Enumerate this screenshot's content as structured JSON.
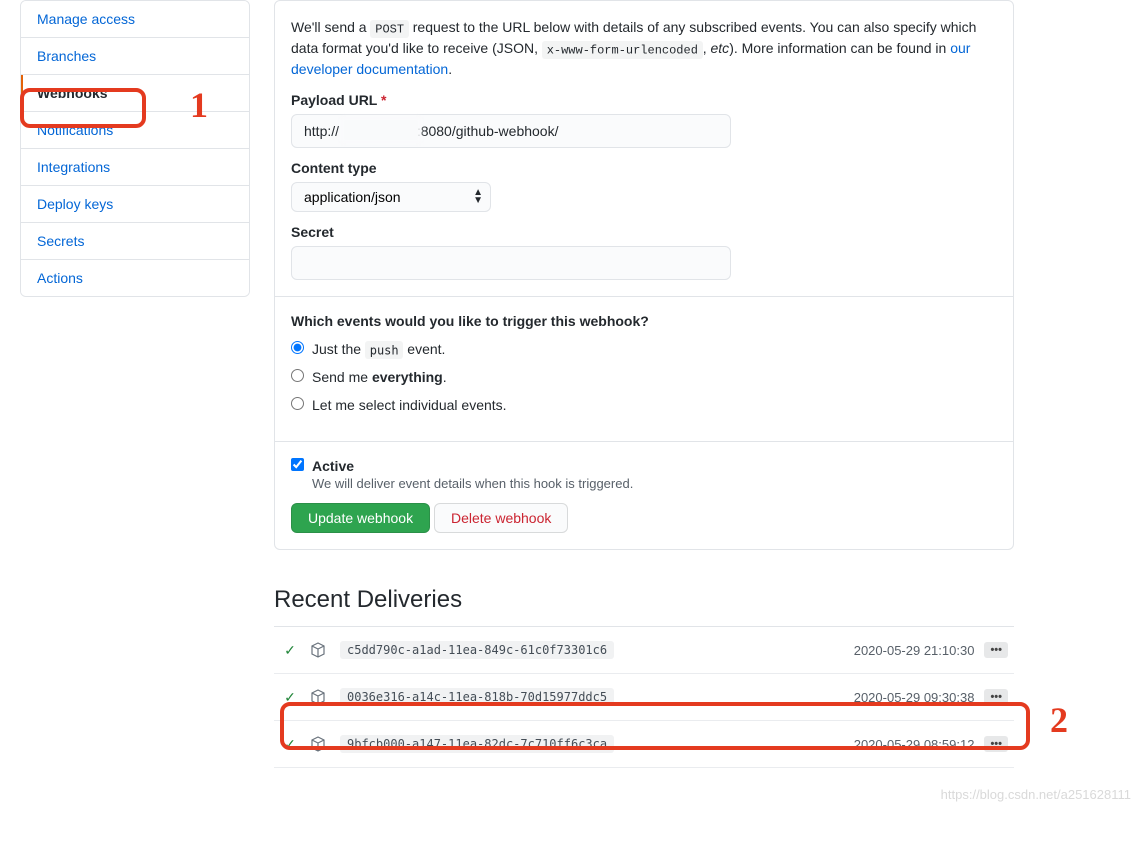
{
  "sidebar": {
    "items": [
      {
        "label": "Manage access",
        "active": false
      },
      {
        "label": "Branches",
        "active": false
      },
      {
        "label": "Webhooks",
        "active": true
      },
      {
        "label": "Notifications",
        "active": false
      },
      {
        "label": "Integrations",
        "active": false
      },
      {
        "label": "Deploy keys",
        "active": false
      },
      {
        "label": "Secrets",
        "active": false
      },
      {
        "label": "Actions",
        "active": false
      }
    ]
  },
  "form": {
    "intro_pre": "We'll send a ",
    "intro_code1": "POST",
    "intro_mid1": " request to the URL below with details of any subscribed events. You can also specify which data format you'd like to receive (JSON, ",
    "intro_code2": "x-www-form-urlencoded",
    "intro_mid2": ", ",
    "intro_etc": "etc",
    "intro_mid3": "). More information can be found in ",
    "intro_link": "our developer documentation",
    "intro_end": ".",
    "payload_label": "Payload URL",
    "payload_value_prefix": "http://",
    "payload_value_suffix": ":8080/github-webhook/",
    "content_type_label": "Content type",
    "content_type_value": "application/json",
    "secret_label": "Secret",
    "secret_value": "",
    "events_title": "Which events would you like to trigger this webhook?",
    "radio_push_pre": "Just the ",
    "radio_push_code": "push",
    "radio_push_post": " event.",
    "radio_everything_pre": "Send me ",
    "radio_everything_strong": "everything",
    "radio_everything_post": ".",
    "radio_individual": "Let me select individual events.",
    "active_label": "Active",
    "active_desc": "We will deliver event details when this hook is triggered.",
    "update_btn": "Update webhook",
    "delete_btn": "Delete webhook"
  },
  "deliveries": {
    "title": "Recent Deliveries",
    "items": [
      {
        "id": "c5dd790c-a1ad-11ea-849c-61c0f73301c6",
        "time": "2020-05-29 21:10:30"
      },
      {
        "id": "0036e316-a14c-11ea-818b-70d15977ddc5",
        "time": "2020-05-29 09:30:38"
      },
      {
        "id": "9bfcb000-a147-11ea-82dc-7c710ff6c3ca",
        "time": "2020-05-29 08:59:12"
      }
    ]
  },
  "annotations": {
    "marker1": "1",
    "marker2": "2"
  },
  "watermark": "https://blog.csdn.net/a251628111"
}
